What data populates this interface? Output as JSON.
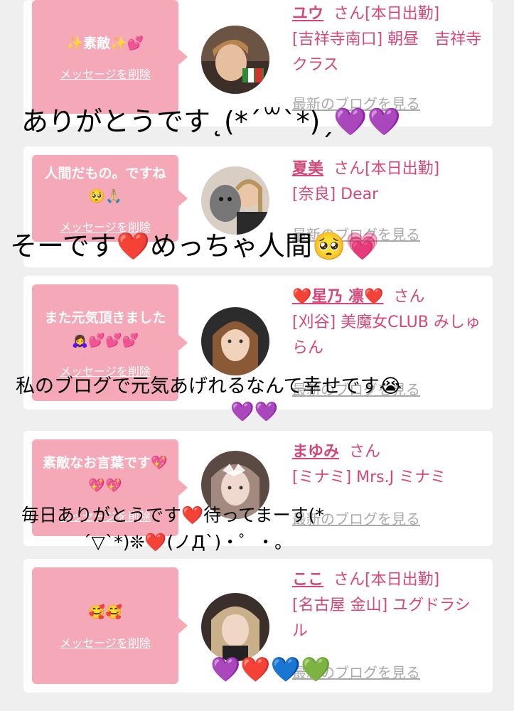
{
  "cards": [
    {
      "bubble_text": "✨素敵✨💕",
      "delete_label": "メッセージを削除",
      "name": "ユウ",
      "san": "さん[本日出勤]",
      "location": "[吉祥寺南口] 朝昼　吉祥寺クラス",
      "blog_label": "最新のブログを見る"
    },
    {
      "bubble_text": "人間だもの。ですね🥺🙏🏼",
      "delete_label": "メッセージを削除",
      "name": "夏美",
      "san": "さん[本日出勤]",
      "location": "[奈良] Dear",
      "blog_label": "最新のブログを見る"
    },
    {
      "bubble_text": "また元気頂きました🙇‍♀️💕💕💕",
      "delete_label": "メッセージを削除",
      "name": "❤️星乃 凛❤️",
      "san": "さん",
      "location": "[刈谷] 美魔女CLUB みしゅらん",
      "blog_label": "最新のブログを見る"
    },
    {
      "bubble_text": "素敵なお言葉です💖💖💖",
      "delete_label": "メッセージを削除",
      "name": "まゆみ",
      "san": "さん",
      "location": "[ミナミ] Mrs.J ミナミ",
      "blog_label": "最新のブログを見る"
    },
    {
      "bubble_text": "🥰🥰",
      "delete_label": "メッセージを削除",
      "name": "ここ",
      "san": "さん[本日出勤]",
      "location": "[名古屋 金山] ユグドラシル",
      "blog_label": "最新のブログを見る"
    }
  ],
  "overlays": {
    "o1": "ありがとうです˛(*´꒳`*)ˏ💜💜",
    "o2": "そーです❤️めっちゃ人間🥺💗",
    "o3a": "私のブログで元気あげれるなんて幸せです😭",
    "o3b": "💜💜",
    "o4a": "毎日ありがとうです❤️待ってまーす(*",
    "o4b": "´▽`*)❊❤️(ノДˋ)・゜・。",
    "o5": "💜❤️💙💚"
  }
}
